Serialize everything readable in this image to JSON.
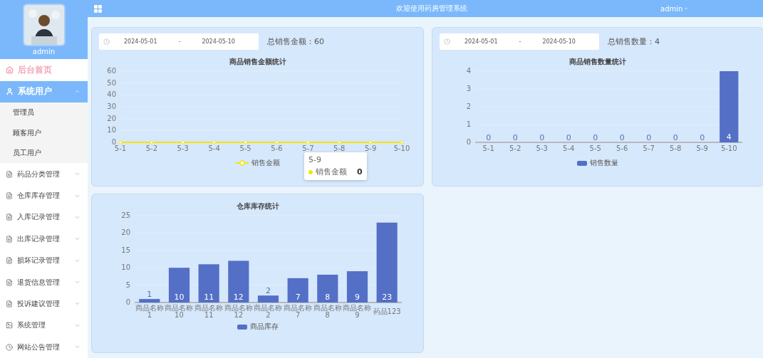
{
  "sidebar": {
    "user": {
      "name": "admin"
    },
    "items": [
      {
        "label": "后台首页",
        "selected": true,
        "expanded": false
      },
      {
        "label": "系统用户",
        "selected": false,
        "expanded": true,
        "children": [
          {
            "label": "管理员"
          },
          {
            "label": "顾客用户"
          },
          {
            "label": "员工用户"
          }
        ]
      },
      {
        "label": "药品分类管理",
        "selected": false,
        "expanded": false
      },
      {
        "label": "仓库库存管理",
        "selected": false,
        "expanded": false
      },
      {
        "label": "入库记录管理",
        "selected": false,
        "expanded": false
      },
      {
        "label": "出库记录管理",
        "selected": false,
        "expanded": false
      },
      {
        "label": "损坏记录管理",
        "selected": false,
        "expanded": false
      },
      {
        "label": "退货信息管理",
        "selected": false,
        "expanded": false
      },
      {
        "label": "投诉建议管理",
        "selected": false,
        "expanded": false
      },
      {
        "label": "系统管理",
        "selected": false,
        "expanded": false
      },
      {
        "label": "网站公告管理",
        "selected": false,
        "expanded": false
      }
    ]
  },
  "header": {
    "title": "欢迎使用药房管理系统",
    "user": "admin"
  },
  "cards": [
    {
      "date_start": "2024-05-01",
      "date_sep": "-",
      "date_end": "2024-05-10",
      "summary": "总销售金额：60",
      "tooltip": {
        "title": "5-9",
        "series": "销售金额",
        "value": "0",
        "color": "#f5e50b"
      },
      "chart_data": {
        "type": "line",
        "title": "商品销售金额统计",
        "grid": true,
        "categories": [
          "5-1",
          "5-2",
          "5-3",
          "5-4",
          "5-5",
          "5-6",
          "5-7",
          "5-8",
          "5-9",
          "5-10"
        ],
        "ylim": [
          0,
          60
        ],
        "yticks": [
          0,
          10,
          20,
          30,
          40,
          50,
          60
        ],
        "series": [
          {
            "name": "销售金额",
            "color": "#f5e50b",
            "marker": true,
            "values": [
              0,
              0,
              0,
              0,
              0,
              0,
              0,
              0,
              0,
              0
            ]
          }
        ]
      }
    },
    {
      "date_start": "2024-05-01",
      "date_sep": "-",
      "date_end": "2024-05-10",
      "summary": "总销售数量：4",
      "chart_data": {
        "type": "bar",
        "title": "商品销售数量统计",
        "grid": true,
        "categories": [
          "5-1",
          "5-2",
          "5-3",
          "5-4",
          "5-5",
          "5-6",
          "5-7",
          "5-8",
          "5-9",
          "5-10"
        ],
        "ylim": [
          0,
          4
        ],
        "yticks": [
          0,
          1,
          2,
          3,
          4
        ],
        "data_labels": true,
        "series": [
          {
            "name": "销售数量",
            "color": "#546fc6",
            "values": [
              0,
              0,
              0,
              0,
              0,
              0,
              0,
              0,
              0,
              4
            ]
          }
        ]
      }
    },
    {
      "chart_data": {
        "type": "bar",
        "title": "仓库库存统计",
        "grid": true,
        "categories": [
          "商品名称1",
          "商品名称10",
          "商品名称11",
          "商品名称12",
          "商品名称2",
          "商品名称7",
          "商品名称8",
          "商品名称9",
          "药品123"
        ],
        "ylim": [
          0,
          25
        ],
        "yticks": [
          0,
          5,
          10,
          15,
          20,
          25
        ],
        "data_labels": true,
        "series": [
          {
            "name": "商品库存",
            "color": "#546fc6",
            "values": [
              1,
              10,
              11,
              12,
              2,
              7,
              8,
              9,
              23
            ]
          }
        ]
      }
    }
  ]
}
